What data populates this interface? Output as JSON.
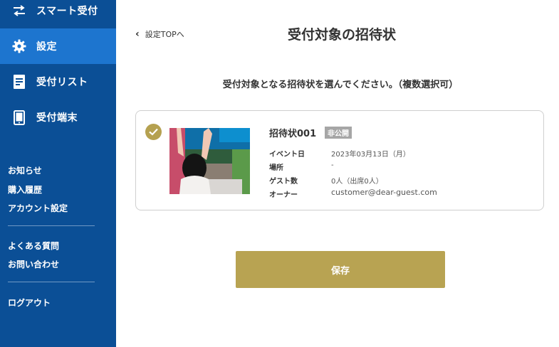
{
  "sidebar": {
    "nav": [
      {
        "label": "スマート受付",
        "icon": "swap-arrows-icon"
      },
      {
        "label": "設定",
        "icon": "gear-icon"
      },
      {
        "label": "受付リスト",
        "icon": "document-list-icon"
      },
      {
        "label": "受付端末",
        "icon": "tablet-icon"
      }
    ],
    "links_group1": [
      "お知らせ",
      "購入履歴",
      "アカウント設定"
    ],
    "links_group2": [
      "よくある質問",
      "お問い合わせ"
    ],
    "logout": "ログアウト"
  },
  "header": {
    "back_label": "設定TOPへ",
    "title": "受付対象の招待状"
  },
  "instruction": "受付対象となる招待状を選んでください。（複数選択可）",
  "invitation": {
    "name": "招待状001",
    "badge": "非公開",
    "selected": true,
    "rows": [
      {
        "label": "イベント日",
        "value": "2023年03月13日（月）"
      },
      {
        "label": "場所",
        "value": "-"
      },
      {
        "label": "ゲスト数",
        "value": "0人（出席0人）"
      },
      {
        "label": "オーナー",
        "value": "customer@dear-guest.com"
      }
    ]
  },
  "save_label": "保存",
  "colors": {
    "sidebar_bg": "#0b4f96",
    "sidebar_active": "#1d75cf",
    "accent_gold": "#b8a352",
    "badge_gray": "#a6a6a6"
  }
}
